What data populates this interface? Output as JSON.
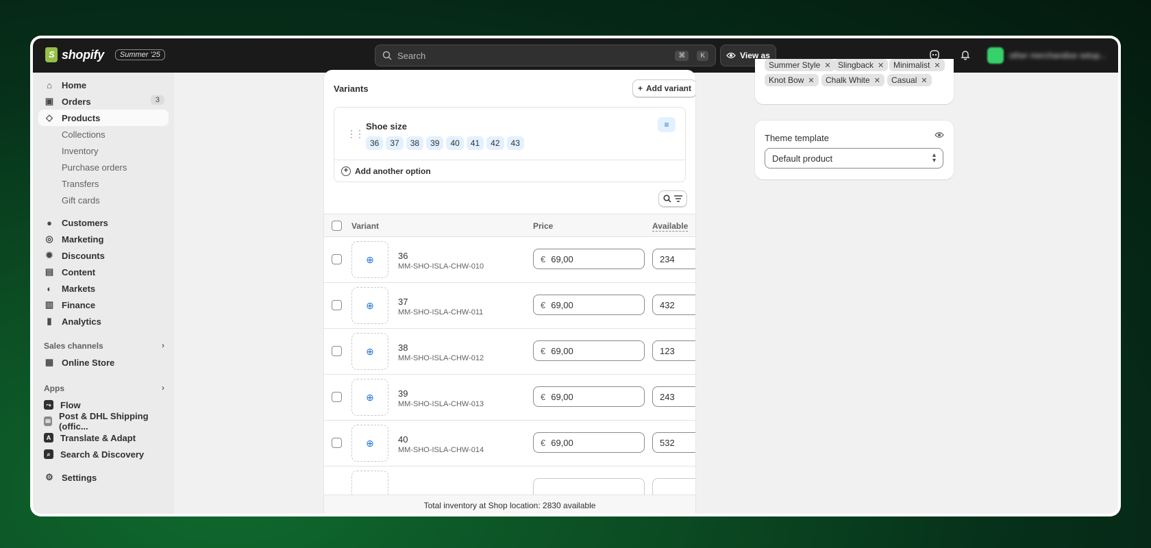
{
  "topbar": {
    "brand": "shopify",
    "edition": "Summer '25",
    "search_placeholder": "Search",
    "shortcut_cmd": "⌘",
    "shortcut_key": "K",
    "view_as": "View as",
    "account_name": "other merchandise setup..."
  },
  "sidebar": {
    "home": "Home",
    "orders": "Orders",
    "orders_badge": "3",
    "products": "Products",
    "collections": "Collections",
    "inventory": "Inventory",
    "purchase_orders": "Purchase orders",
    "transfers": "Transfers",
    "gift_cards": "Gift cards",
    "customers": "Customers",
    "marketing": "Marketing",
    "discounts": "Discounts",
    "content": "Content",
    "markets": "Markets",
    "finance": "Finance",
    "analytics": "Analytics",
    "sales_channels": "Sales channels",
    "online_store": "Online Store",
    "apps": "Apps",
    "flow": "Flow",
    "post_dhl": "Post & DHL Shipping (offic...",
    "translate": "Translate & Adapt",
    "search_discovery": "Search & Discovery",
    "settings": "Settings"
  },
  "variants": {
    "title": "Variants",
    "add_variant": "Add variant",
    "option_name": "Shoe size",
    "option_values": [
      "36",
      "37",
      "38",
      "39",
      "40",
      "41",
      "42",
      "43"
    ],
    "add_option": "Add another option",
    "col_variant": "Variant",
    "col_price": "Price",
    "col_available": "Available",
    "rows": [
      {
        "name": "36",
        "sku": "MM-SHO-ISLA-CHW-010",
        "currency": "€",
        "price": "69,00",
        "available": "234"
      },
      {
        "name": "37",
        "sku": "MM-SHO-ISLA-CHW-011",
        "currency": "€",
        "price": "69,00",
        "available": "432"
      },
      {
        "name": "38",
        "sku": "MM-SHO-ISLA-CHW-012",
        "currency": "€",
        "price": "69,00",
        "available": "123"
      },
      {
        "name": "39",
        "sku": "MM-SHO-ISLA-CHW-013",
        "currency": "€",
        "price": "69,00",
        "available": "243"
      },
      {
        "name": "40",
        "sku": "MM-SHO-ISLA-CHW-014",
        "currency": "€",
        "price": "69,00",
        "available": "532"
      }
    ],
    "total_inventory": "Total inventory at Shop location: 2830 available"
  },
  "tags": {
    "items": [
      "Summer Style",
      "Slingback",
      "Minimalist",
      "Knot Bow",
      "Chalk White",
      "Casual"
    ]
  },
  "theme": {
    "title": "Theme template",
    "selected": "Default product"
  }
}
